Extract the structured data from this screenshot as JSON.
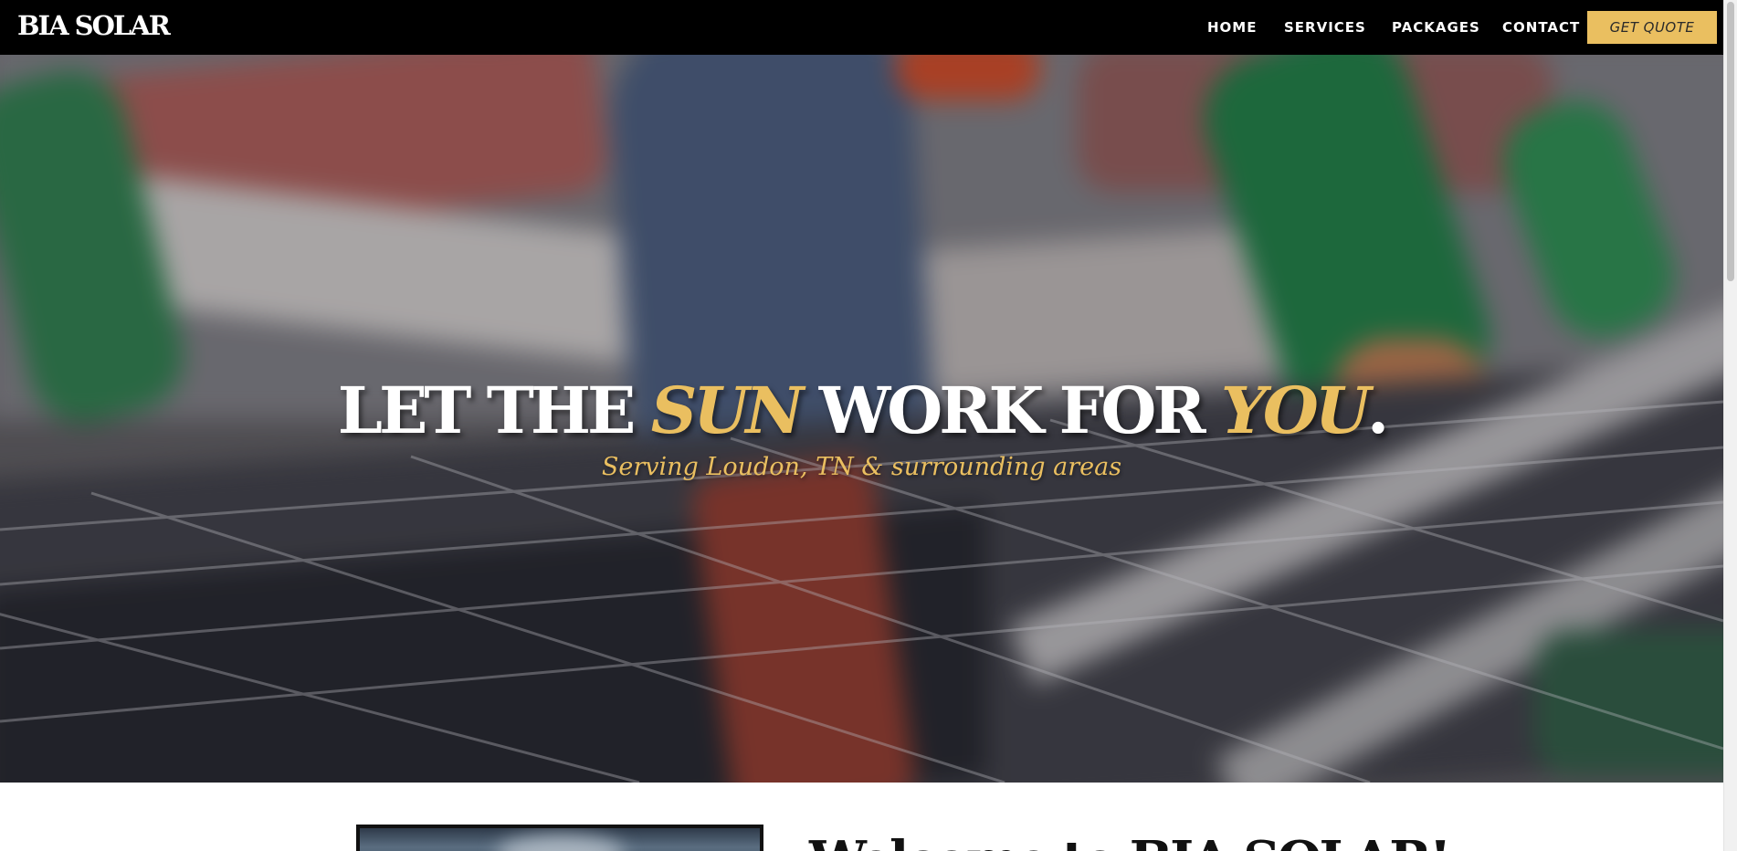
{
  "brand": {
    "logo": "BIA SOLAR"
  },
  "nav": {
    "links": [
      {
        "label": "HOME"
      },
      {
        "label": "SERVICES"
      },
      {
        "label": "PACKAGES"
      },
      {
        "label": "CONTACT"
      }
    ],
    "cta_label": "GET QUOTE"
  },
  "hero": {
    "title_part1": "LET THE ",
    "title_accent1": "SUN",
    "title_part2": " WORK FOR ",
    "title_accent2": "YOU",
    "title_end": ".",
    "subtitle": "Serving Loudon, TN & surrounding areas"
  },
  "intro": {
    "heading": "Welcome to BIA SOLAR!"
  },
  "colors": {
    "accent": "#eabf60",
    "nav_bg": "#000000",
    "text_light": "#ffffff"
  }
}
